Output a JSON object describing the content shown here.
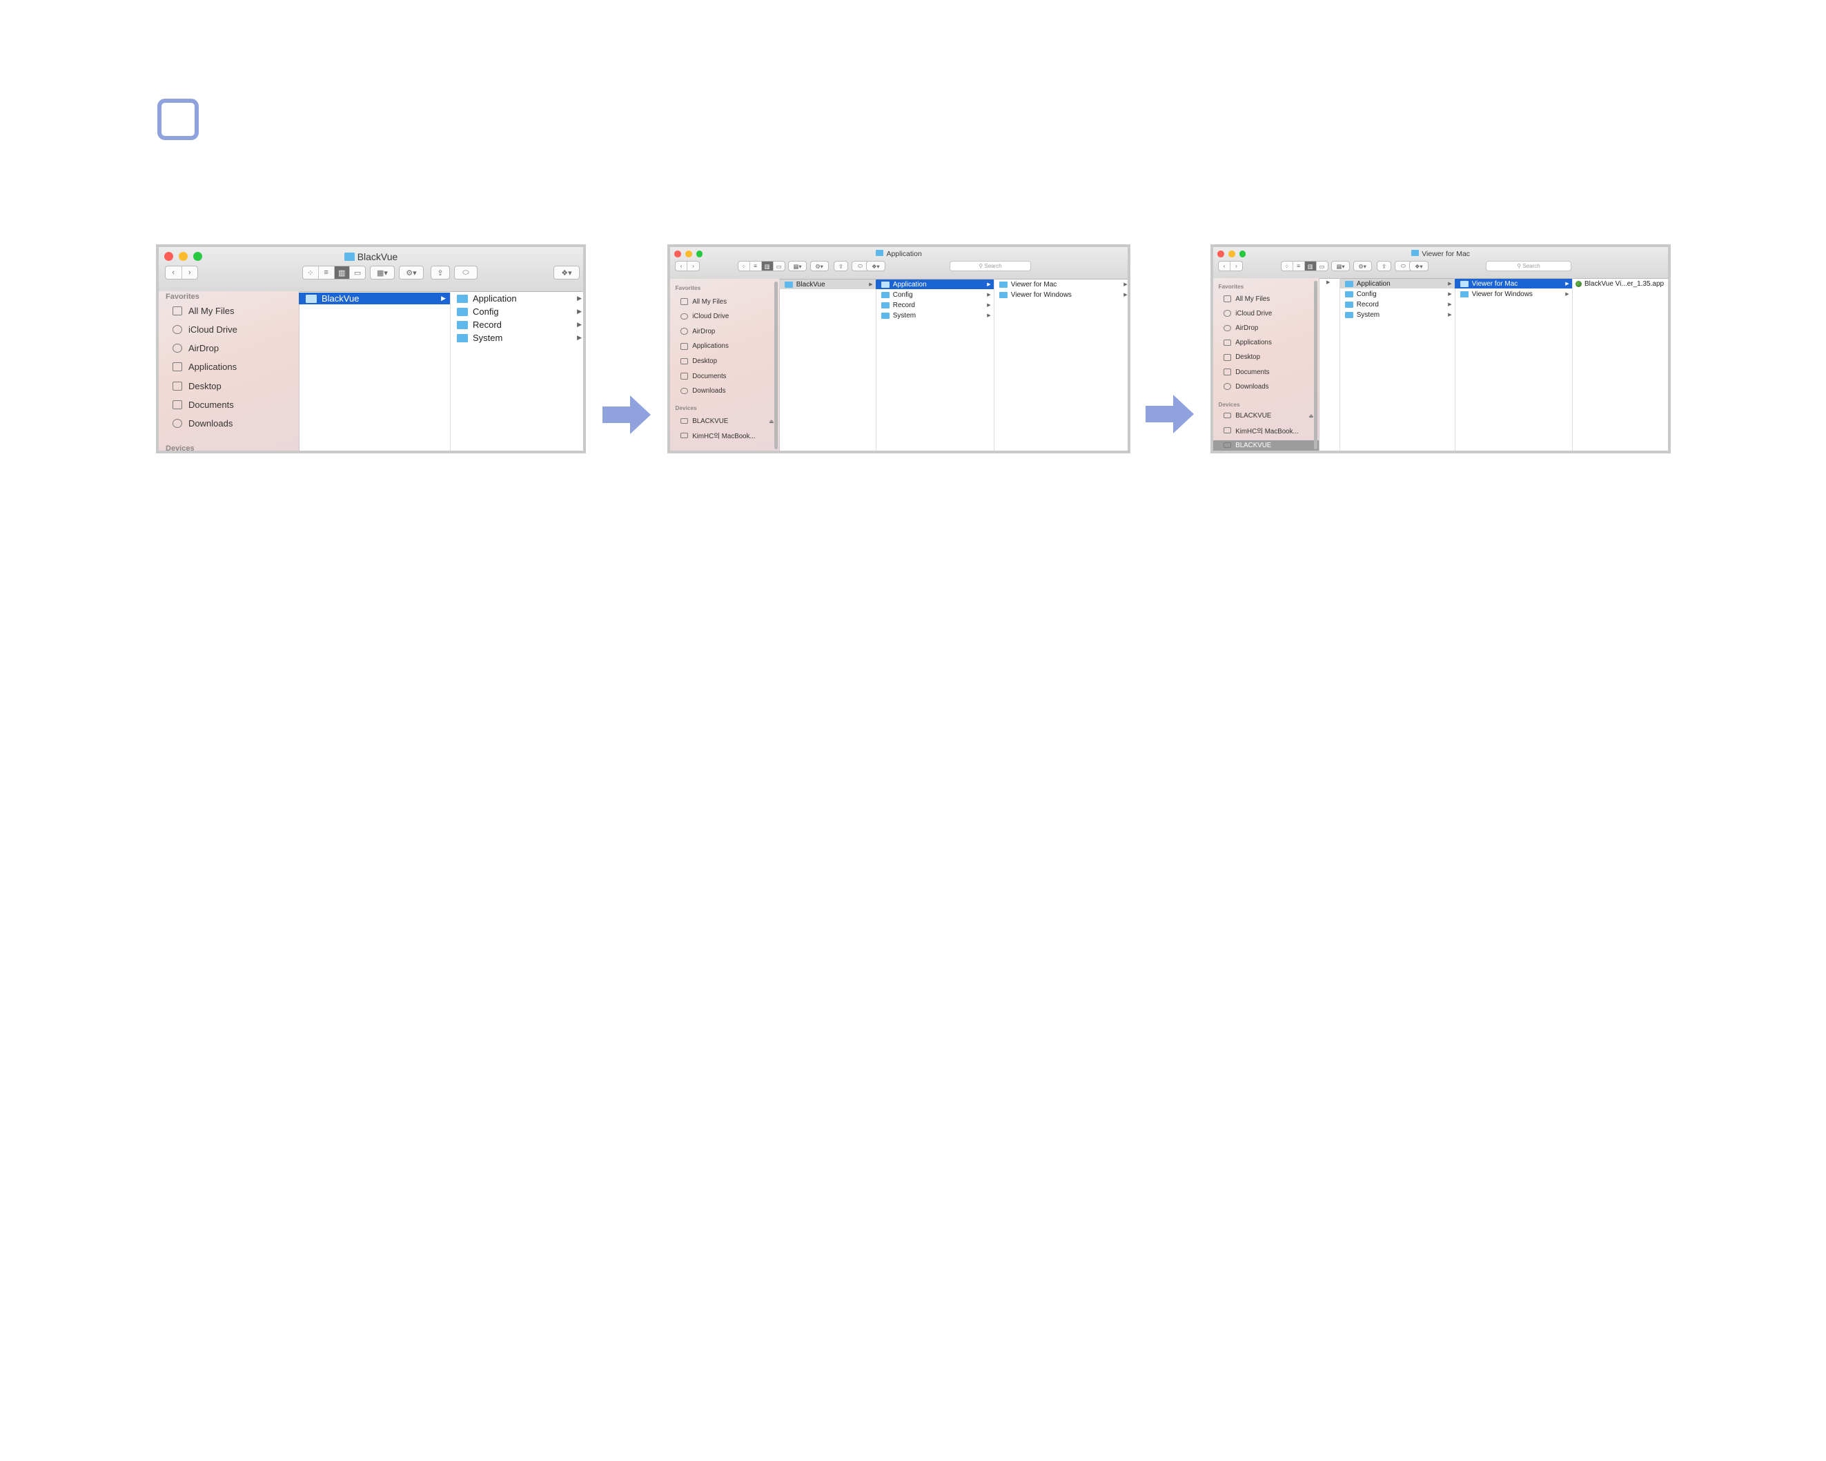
{
  "windows": [
    {
      "title": "BlackVue",
      "sidebar": {
        "favorites_label": "Favorites",
        "favorites": [
          "All My Files",
          "iCloud Drive",
          "AirDrop",
          "Applications",
          "Desktop",
          "Documents",
          "Downloads"
        ],
        "devices_label": "Devices"
      },
      "columns": [
        {
          "items": [
            {
              "label": "BlackVue",
              "state": "selected"
            }
          ]
        },
        {
          "items": [
            {
              "label": "Application"
            },
            {
              "label": "Config"
            },
            {
              "label": "Record"
            },
            {
              "label": "System"
            }
          ]
        }
      ]
    },
    {
      "title": "Application",
      "search_placeholder": "Search",
      "sidebar": {
        "favorites_label": "Favorites",
        "favorites": [
          "All My Files",
          "iCloud Drive",
          "AirDrop",
          "Applications",
          "Desktop",
          "Documents",
          "Downloads"
        ],
        "devices_label": "Devices",
        "devices": [
          "BLACKVUE",
          "KimHC의 MacBook..."
        ]
      },
      "columns": [
        {
          "items": [
            {
              "label": "BlackVue",
              "state": "dim"
            }
          ]
        },
        {
          "items": [
            {
              "label": "Application",
              "state": "selected"
            },
            {
              "label": "Config"
            },
            {
              "label": "Record"
            },
            {
              "label": "System"
            }
          ]
        },
        {
          "items": [
            {
              "label": "Viewer for Mac"
            },
            {
              "label": "Viewer for Windows"
            }
          ]
        }
      ]
    },
    {
      "title": "Viewer for Mac",
      "search_placeholder": "Search",
      "sidebar": {
        "favorites_label": "Favorites",
        "favorites": [
          "All My Files",
          "iCloud Drive",
          "AirDrop",
          "Applications",
          "Desktop",
          "Documents",
          "Downloads"
        ],
        "devices_label": "Devices",
        "devices": [
          "BLACKVUE",
          "KimHC의 MacBook...",
          "BLACKVUE"
        ]
      },
      "columns": [
        {
          "items": []
        },
        {
          "items": [
            {
              "label": "Application",
              "state": "dim"
            },
            {
              "label": "Config"
            },
            {
              "label": "Record"
            },
            {
              "label": "System"
            }
          ]
        },
        {
          "items": [
            {
              "label": "Viewer for Mac",
              "state": "selected"
            },
            {
              "label": "Viewer for Windows"
            }
          ]
        },
        {
          "items": [
            {
              "label": "BlackVue Vi...er_1.35.app",
              "kind": "app"
            }
          ]
        }
      ]
    }
  ],
  "colors": {
    "accent": "#8fa2dd",
    "selection": "#1a64d4",
    "folder": "#5fb8ec"
  },
  "icons": [
    "step-marker-icon",
    "arrow-right-icon",
    "folder-icon",
    "app-icon"
  ]
}
